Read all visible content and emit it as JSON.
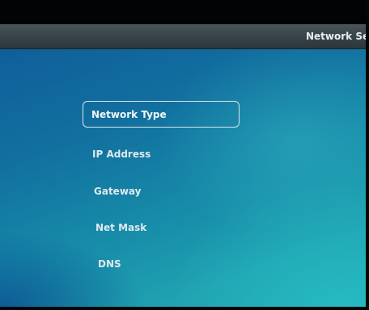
{
  "header": {
    "title": "Network Set"
  },
  "menu": {
    "items": [
      {
        "label": "Network Type",
        "selected": true
      },
      {
        "label": "IP Address",
        "selected": false
      },
      {
        "label": "Gateway",
        "selected": false
      },
      {
        "label": "Net Mask",
        "selected": false
      },
      {
        "label": "DNS",
        "selected": false
      }
    ]
  },
  "colors": {
    "background_top": "#0f5f9a",
    "background_bottom": "#23aab2",
    "title_bar": "#3a454b",
    "text": "#dfe9ee"
  }
}
